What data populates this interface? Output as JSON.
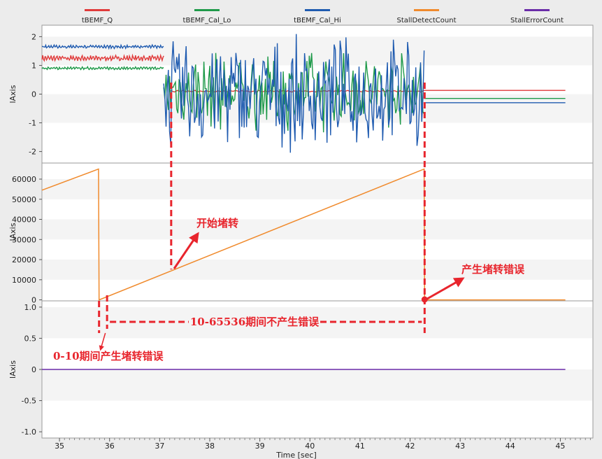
{
  "chart_data": {
    "type": "line",
    "xlabel": "Time [sec]",
    "x_ticks": [
      "35",
      "36",
      "37",
      "38",
      "39",
      "40",
      "41",
      "42",
      "43",
      "44",
      "45"
    ],
    "xlim": [
      34.65,
      45.65
    ],
    "legend": {
      "placement": "top",
      "entries": [
        {
          "name": "tBEMF_Q",
          "color": "#e03a3a"
        },
        {
          "name": "tBEMF_Cal_Lo",
          "color": "#1f9a4a"
        },
        {
          "name": "tBEMF_Cal_Hi",
          "color": "#1f5bb0"
        },
        {
          "name": "StallDetectCount",
          "color": "#f08a2c"
        },
        {
          "name": "StallErrorCount",
          "color": "#6a2ca8"
        }
      ]
    },
    "panels": [
      {
        "ylabel": "lAxis",
        "ylim": [
          -2.4,
          2.4
        ],
        "y_ticks": [
          "2",
          "1",
          "0",
          "-1",
          "-2"
        ],
        "series": [
          {
            "name": "tBEMF_Q",
            "color": "#e03a3a",
            "segments": [
              {
                "kind": "noisy",
                "x": [
                  34.65,
                  37.08
                ],
                "level": 1.25,
                "amplitude": 0.1
              },
              {
                "kind": "noisy",
                "x": [
                  37.2,
                  42.28
                ],
                "level": 0.1,
                "amplitude": 0.03
              },
              {
                "kind": "flat",
                "x": [
                  42.28,
                  45.1
                ],
                "level": 0.13
              }
            ]
          },
          {
            "name": "tBEMF_Cal_Lo",
            "color": "#1f9a4a",
            "segments": [
              {
                "kind": "noisy",
                "x": [
                  34.65,
                  37.08
                ],
                "level": 0.9,
                "amplitude": 0.05
              },
              {
                "kind": "chaotic",
                "x": [
                  37.08,
                  42.28
                ],
                "level": 0.1,
                "amplitude": 1.5
              },
              {
                "kind": "flat",
                "x": [
                  42.28,
                  45.1
                ],
                "level": -0.15
              }
            ]
          },
          {
            "name": "tBEMF_Cal_Hi",
            "color": "#1f5bb0",
            "segments": [
              {
                "kind": "noisy",
                "x": [
                  34.65,
                  37.08
                ],
                "level": 1.65,
                "amplitude": 0.06
              },
              {
                "kind": "chaotic",
                "x": [
                  37.08,
                  42.28
                ],
                "level": 0.0,
                "amplitude": 2.1
              },
              {
                "kind": "flat",
                "x": [
                  42.28,
                  45.1
                ],
                "level": -0.3
              }
            ]
          }
        ]
      },
      {
        "ylabel": "lAxis",
        "ylim": [
          -500,
          68000
        ],
        "y_ticks": [
          "60000",
          "50000",
          "40000",
          "30000",
          "20000",
          "10000",
          "0"
        ],
        "series": [
          {
            "name": "StallDetectCount",
            "color": "#f08a2c",
            "points": [
              [
                34.65,
                54500
              ],
              [
                35.78,
                65000
              ],
              [
                35.79,
                0
              ],
              [
                42.28,
                65000
              ],
              [
                42.29,
                0
              ],
              [
                45.1,
                0
              ]
            ]
          }
        ]
      },
      {
        "ylabel": "lAxis",
        "ylim": [
          -1.1,
          1.1
        ],
        "y_ticks": [
          "1.0",
          "0.5",
          "0",
          "-0.5",
          "-1.0"
        ],
        "series": [
          {
            "name": "StallErrorCount",
            "color": "#6a2ca8",
            "points": [
              [
                34.65,
                0
              ],
              [
                45.1,
                0
              ]
            ]
          }
        ]
      }
    ],
    "annotations": [
      {
        "text": "开始堵转"
      },
      {
        "text": "产生堵转错误"
      },
      {
        "text": "10-65536期间不产生错误"
      },
      {
        "text": "0-10期间产生堵转错误"
      }
    ]
  }
}
